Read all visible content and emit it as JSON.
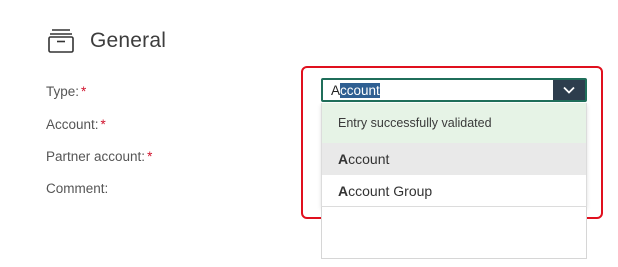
{
  "section": {
    "title": "General",
    "icon": "archive-box-icon"
  },
  "form": {
    "required_mark": "*",
    "fields": [
      {
        "label": "Type:"
      },
      {
        "label": "Account:"
      },
      {
        "label": "Partner account:"
      },
      {
        "label": "Comment:"
      }
    ]
  },
  "type_select": {
    "value_typed": "A",
    "value_selected_suffix": "ccount",
    "dropdown_icon": "chevron-down-icon",
    "status_text": "Entry successfully validated",
    "options": [
      {
        "match": "A",
        "rest": "ccount",
        "highlighted": true
      },
      {
        "match": "A",
        "rest": "ccount Group",
        "highlighted": false
      }
    ]
  },
  "colors": {
    "highlight_border": "#e0101e",
    "required": "#d0122c",
    "selection": "#2f5f92",
    "validated_bg": "#e6f3e6",
    "dropdown_button": "#2d3d4d"
  }
}
